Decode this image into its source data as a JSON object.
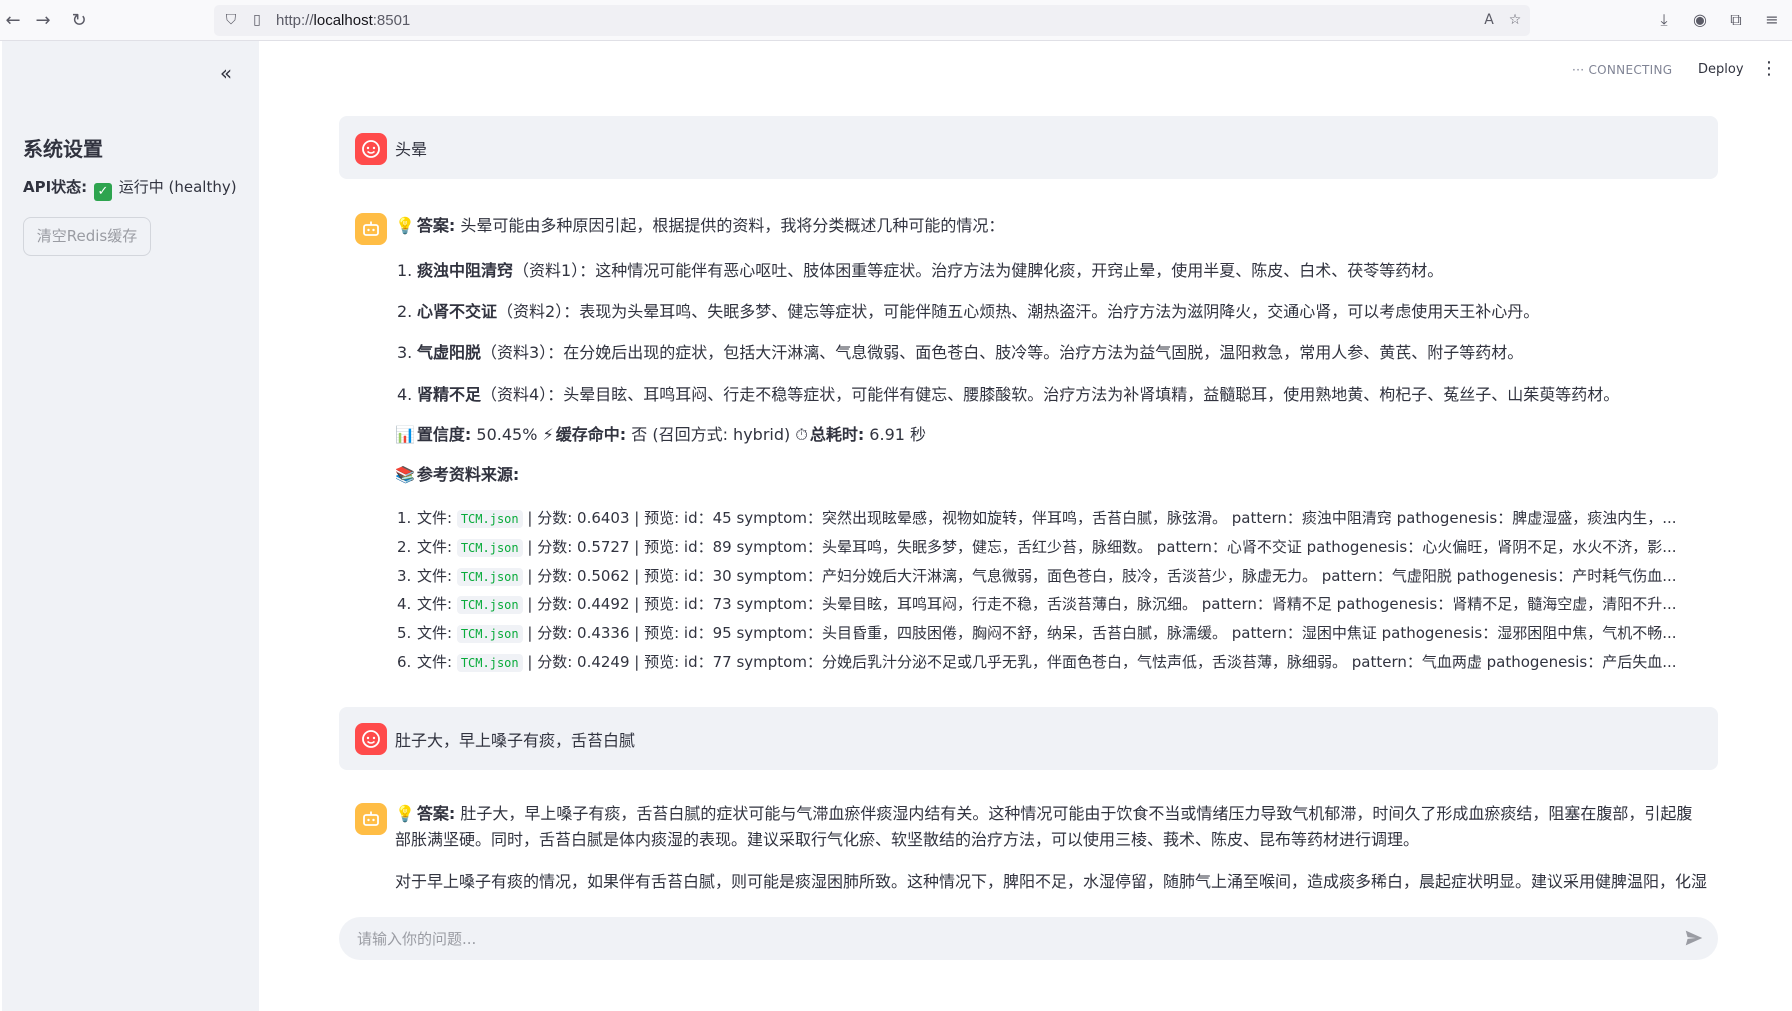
{
  "browser": {
    "url_scheme": "http://",
    "url_host": "localhost",
    "url_port": ":8501"
  },
  "sidebar": {
    "title": "系统设置",
    "api_label": "API状态:",
    "api_status": "运行中 (healthy)",
    "clear_button": "清空Redis缓存"
  },
  "header": {
    "status": "CONNECTING",
    "deploy": "Deploy"
  },
  "chat": {
    "q1": "头晕",
    "a1": {
      "answer_label": "答案:",
      "answer_text": " 头晕可能由多种原因引起，根据提供的资料，我将分类概述几种可能的情况：",
      "items": [
        {
          "num": "1.",
          "title": "痰浊中阻清窍",
          "text": "（资料1）：这种情况可能伴有恶心呕吐、肢体困重等症状。治疗方法为健脾化痰，开窍止晕，使用半夏、陈皮、白术、茯苓等药材。"
        },
        {
          "num": "2.",
          "title": "心肾不交证",
          "text": "（资料2）：表现为头晕耳鸣、失眠多梦、健忘等症状，可能伴随五心烦热、潮热盗汗。治疗方法为滋阴降火，交通心肾，可以考虑使用天王补心丹。"
        },
        {
          "num": "3.",
          "title": "气虚阳脱",
          "text": "（资料3）：在分娩后出现的症状，包括大汗淋漓、气息微弱、面色苍白、肢冷等。治疗方法为益气固脱，温阳救急，常用人参、黄芪、附子等药材。"
        },
        {
          "num": "4.",
          "title": "肾精不足",
          "text": "（资料4）：头晕目眩、耳鸣耳闷、行走不稳等症状，可能伴有健忘、腰膝酸软。治疗方法为补肾填精，益髓聪耳，使用熟地黄、枸杞子、菟丝子、山茱萸等药材。"
        }
      ],
      "meta": {
        "conf_label": "置信度:",
        "conf_value": " 50.45% ",
        "cache_label": "缓存命中:",
        "cache_value": " 否 (召回方式: hybrid) ",
        "time_label": "总耗时:",
        "time_value": " 6.91 秒"
      },
      "sources_label": "参考资料来源:",
      "sources": [
        {
          "num": "1.",
          "file_label": "文件: ",
          "file": "TCM.json",
          "rest": " | 分数: 0.6403 | 预览: id：45 symptom：突然出现眩晕感，视物如旋转，伴耳鸣，舌苔白腻，脉弦滑。 pattern：痰浊中阻清窍 pathogenesis：脾虚湿盛，痰浊内生，..."
        },
        {
          "num": "2.",
          "file_label": "文件: ",
          "file": "TCM.json",
          "rest": " | 分数: 0.5727 | 预览: id：89 symptom：头晕耳鸣，失眠多梦，健忘，舌红少苔，脉细数。 pattern：心肾不交证 pathogenesis：心火偏旺，肾阴不足，水火不济，影..."
        },
        {
          "num": "3.",
          "file_label": "文件: ",
          "file": "TCM.json",
          "rest": " | 分数: 0.5062 | 预览: id：30 symptom：产妇分娩后大汗淋漓，气息微弱，面色苍白，肢冷，舌淡苔少，脉虚无力。 pattern：气虚阳脱 pathogenesis：产时耗气伤血..."
        },
        {
          "num": "4.",
          "file_label": "文件: ",
          "file": "TCM.json",
          "rest": " | 分数: 0.4492 | 预览: id：73 symptom：头晕目眩，耳鸣耳闷，行走不稳，舌淡苔薄白，脉沉细。 pattern：肾精不足 pathogenesis：肾精不足，髓海空虚，清阳不升..."
        },
        {
          "num": "5.",
          "file_label": "文件: ",
          "file": "TCM.json",
          "rest": " | 分数: 0.4336 | 预览: id：95 symptom：头目昏重，四肢困倦，胸闷不舒，纳呆，舌苔白腻，脉濡缓。 pattern：湿困中焦证 pathogenesis：湿邪困阻中焦，气机不畅..."
        },
        {
          "num": "6.",
          "file_label": "文件: ",
          "file": "TCM.json",
          "rest": " | 分数: 0.4249 | 预览: id：77 symptom：分娩后乳汁分泌不足或几乎无乳，伴面色苍白，气怯声低，舌淡苔薄，脉细弱。 pattern：气血两虚 pathogenesis：产后失血..."
        }
      ]
    },
    "q2": "肚子大，早上嗓子有痰，舌苔白腻",
    "a2": {
      "answer_label": "答案:",
      "answer_text": " 肚子大，早上嗓子有痰，舌苔白腻的症状可能与气滞血瘀伴痰湿内结有关。这种情况可能由于饮食不当或情绪压力导致气机郁滞，时间久了形成血瘀痰结，阻塞在腹部，引起腹部胀满坚硬。同时，舌苔白腻是体内痰湿的表现。建议采取行气化瘀、软坚散结的治疗方法，可以使用三棱、莪术、陈皮、昆布等药材进行调理。",
      "para2": "对于早上嗓子有痰的情况，如果伴有舌苔白腻，则可能是痰湿困肺所致。这种情况下，脾阳不足，水湿停留，随肺气上涌至喉间，造成痰多稀白，晨起症状明显。建议采用健脾温阳，化湿"
    }
  },
  "input": {
    "placeholder": "请输入你的问题..."
  },
  "colors": {
    "user_avatar": "#ff4b4b",
    "assistant_avatar": "#ffbd45",
    "code_text": "#09ab3b"
  }
}
